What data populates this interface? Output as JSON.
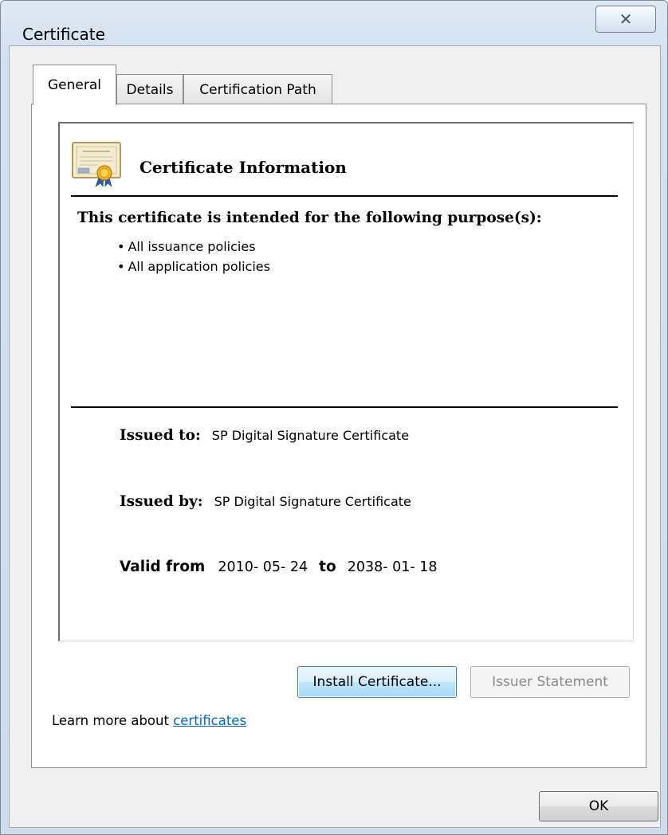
{
  "window": {
    "title": "Certificate",
    "close_glyph": "✕"
  },
  "tabs": [
    {
      "label": "General",
      "active": true
    },
    {
      "label": "Details",
      "active": false
    },
    {
      "label": "Certification Path",
      "active": false
    }
  ],
  "general": {
    "icon": "certificate-icon",
    "heading": "Certificate Information",
    "purpose_title": "This certificate is intended for the following purpose(s):",
    "purposes": [
      "All issuance policies",
      "All application policies"
    ],
    "issued_to_label": "Issued to:",
    "issued_to_value": "SP Digital Signature Certificate",
    "issued_by_label": "Issued by:",
    "issued_by_value": "SP Digital Signature Certificate",
    "valid_from_label": "Valid from",
    "valid_from_value": "2010- 05- 24",
    "valid_to_label": "to",
    "valid_to_value": "2038- 01- 18"
  },
  "buttons": {
    "install_certificate": "Install Certificate...",
    "issuer_statement": "Issuer Statement",
    "ok": "OK"
  },
  "learn_more": {
    "prefix": "Learn more about ",
    "link": "certificates"
  },
  "colors": {
    "link": "#0066cc",
    "disabled_text": "#8a8a8a",
    "primary_border": "#3c7fb1"
  }
}
